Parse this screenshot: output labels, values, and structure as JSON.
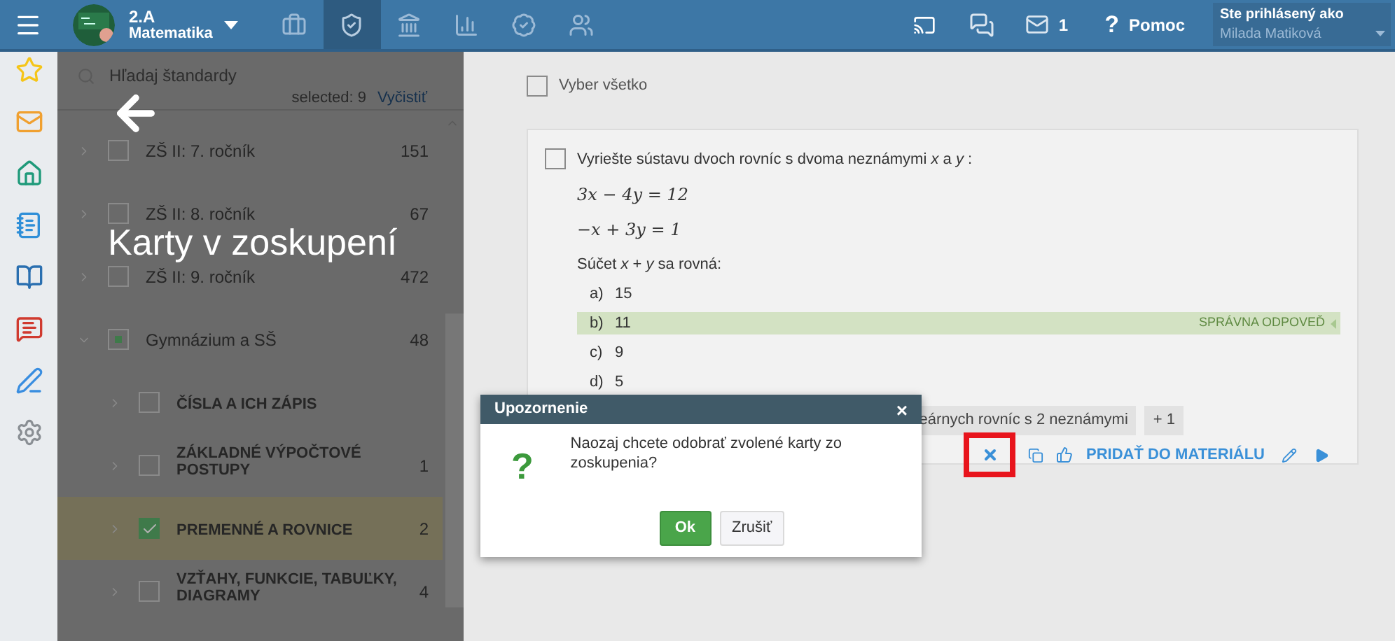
{
  "topbar": {
    "class_name": "2.A",
    "subject": "Matematika",
    "nav": [
      {
        "kind": "briefcase",
        "selected": false
      },
      {
        "kind": "shield",
        "selected": true
      },
      {
        "kind": "bank",
        "selected": false
      },
      {
        "kind": "chart",
        "selected": false
      },
      {
        "kind": "badge",
        "selected": false
      },
      {
        "kind": "hikers",
        "selected": false
      }
    ],
    "messages_count": "1",
    "help_icon": "?",
    "help": "Pomoc",
    "user_label": "Ste prihlásený ako",
    "user_name": "Milada Matiková"
  },
  "side_icons": [
    {
      "kind": "star"
    },
    {
      "kind": "mail"
    },
    {
      "kind": "home"
    },
    {
      "kind": "notebook"
    },
    {
      "kind": "book"
    },
    {
      "kind": "chat"
    },
    {
      "kind": "pen"
    },
    {
      "kind": "gear"
    }
  ],
  "standards": {
    "search_placeholder": "Hľadaj štandardy",
    "selected_text": "selected: 9",
    "clear": "Vyčistiť",
    "overlay_title": "Karty v zoskupení",
    "tree": [
      {
        "label": "ZŠ II: 7. ročník",
        "count": "151",
        "checked": false,
        "partial": false,
        "expanded": false,
        "selected": false
      },
      {
        "label": "ZŠ II: 8. ročník",
        "count": "67",
        "checked": false,
        "partial": false,
        "expanded": false,
        "selected": false
      },
      {
        "label": "ZŠ II: 9. ročník",
        "count": "472",
        "checked": false,
        "partial": false,
        "expanded": false,
        "selected": false
      },
      {
        "label": "Gymnázium a SŠ",
        "count": "48",
        "checked": false,
        "partial": true,
        "expanded": true,
        "selected": false,
        "children": [
          {
            "label": "ČÍSLA A ICH ZÁPIS",
            "checked": false,
            "partial": false,
            "expanded": false,
            "selected": false
          },
          {
            "label": "ZÁKLADNÉ VÝPOČTOVÉ POSTUPY",
            "count": "1",
            "checked": false,
            "partial": false,
            "expanded": false,
            "selected": false
          },
          {
            "label": "PREMENNÉ A ROVNICE",
            "count": "2",
            "checked": true,
            "partial": false,
            "expanded": false,
            "selected": true
          },
          {
            "label": "VZŤAHY, FUNKCIE, TABUĽKY, DIAGRAMY",
            "count": "4",
            "checked": false,
            "partial": false,
            "expanded": false,
            "selected": false
          }
        ]
      }
    ]
  },
  "select_all": {
    "label": "Vyber všetko",
    "checked": false
  },
  "card": {
    "checked": false,
    "question": "Vyriešte sústavu dvoch rovníc s dvoma neznámymi *x* a *y* :",
    "equations": [
      "3x − 4y = 12",
      "−x + 3y = 1"
    ],
    "prompt": "Súčet *x* + *y* sa rovná:",
    "answers": [
      {
        "letter": "a)",
        "text": "15",
        "correct": false
      },
      {
        "letter": "b)",
        "text": "11",
        "correct": true
      },
      {
        "letter": "c)",
        "text": "9",
        "correct": false
      },
      {
        "letter": "d)",
        "text": "5",
        "correct": false
      }
    ],
    "correct_label": "SPRÁVNA ODPOVEĎ",
    "tags": [
      "eárnych rovníc s 2 neznámymi",
      "+ 1"
    ],
    "add_label": "PRIDAŤ DO MATERIÁLU",
    "remove_highlighted": true
  },
  "dialog": {
    "title": "Upozornenie",
    "close": "×",
    "icon": "?",
    "message": "Naozaj chcete odobrať zvolené karty zo zoskupenia?",
    "ok": "Ok",
    "cancel": "Zrušiť"
  }
}
